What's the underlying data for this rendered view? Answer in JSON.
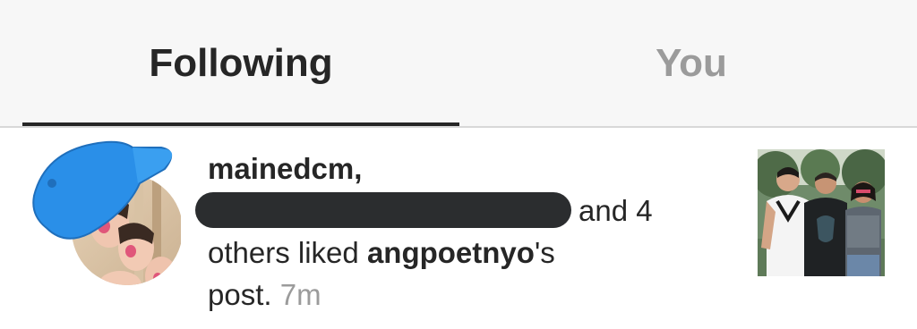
{
  "tabs": {
    "following": "Following",
    "you": "You"
  },
  "notification": {
    "actor": "mainedcm,",
    "text_part_1": "and 4",
    "text_part_2": "others liked",
    "target_user": "angpoetnyo",
    "possessive": "'s",
    "text_part_3": "post.",
    "timestamp": "7m"
  },
  "colors": {
    "active_tab": "#262626",
    "inactive_tab": "#9b9b9b",
    "redaction": "#2b2d2f",
    "cap": "#2a8fe8"
  },
  "icons": {
    "avatar": "user-avatar-with-blue-cap",
    "post_thumbnail": "group-photo-thumbnail"
  }
}
